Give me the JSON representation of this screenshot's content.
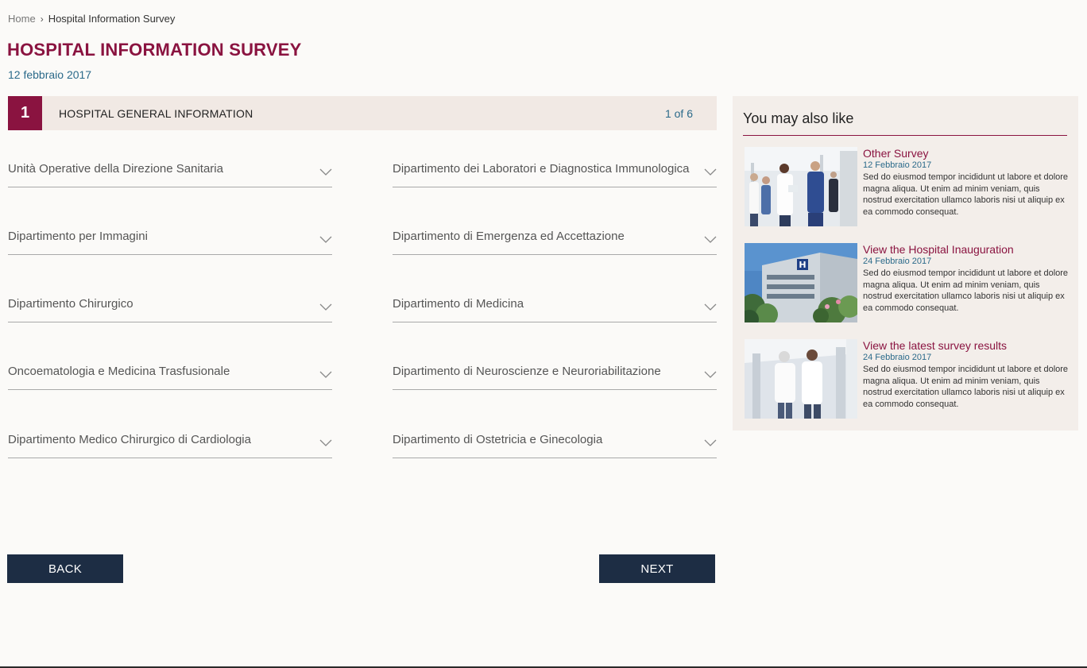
{
  "breadcrumb": {
    "home": "Home",
    "separator": "›",
    "current": "Hospital Information Survey"
  },
  "page": {
    "title": "HOSPITAL INFORMATION SURVEY",
    "date": "12 febbraio 2017"
  },
  "step": {
    "number": "1",
    "title": "HOSPITAL GENERAL INFORMATION",
    "progress": "1 of 6"
  },
  "departments": {
    "left": [
      "Unità Operative della Direzione Sanitaria",
      "Dipartimento per Immagini",
      "Dipartimento Chirurgico",
      "Oncoematologia e Medicina Trasfusionale",
      "Dipartimento Medico Chirurgico di Cardiologia"
    ],
    "right": [
      "Dipartimento dei Laboratori e Diagnostica Immunologica",
      "Dipartimento di Emergenza ed Accettazione",
      "Dipartimento di Medicina",
      "Dipartimento di Neuroscienze e Neuroriabilitazione",
      "Dipartimento di Ostetricia e Ginecologia"
    ]
  },
  "buttons": {
    "back": "BACK",
    "next": "NEXT"
  },
  "sidebar": {
    "title": "You may also like",
    "items": [
      {
        "title": "Other Survey",
        "date": "12 Febbraio 2017",
        "description": "Sed do eiusmod tempor incididunt ut labore et dolore magna aliqua. Ut enim ad minim veniam, quis nostrud exercitation ullamco laboris nisi ut aliquip ex ea commodo consequat."
      },
      {
        "title": "View the Hospital Inauguration",
        "date": "24 Febbraio 2017",
        "description": "Sed do eiusmod tempor incididunt ut labore et dolore magna aliqua. Ut enim ad minim veniam, quis nostrud exercitation ullamco laboris nisi ut aliquip ex ea commodo consequat."
      },
      {
        "title": "View the latest survey results",
        "date": "24 Febbraio 2017",
        "description": "Sed do eiusmod tempor incididunt ut labore et dolore magna aliqua. Ut enim ad minim veniam, quis nostrud exercitation ullamco laboris nisi ut aliquip ex ea commodo consequat."
      }
    ]
  },
  "colors": {
    "brand": "#8a1340",
    "accent": "#2b6a8a",
    "button": "#1d2d44",
    "panel": "#f3eeea"
  }
}
